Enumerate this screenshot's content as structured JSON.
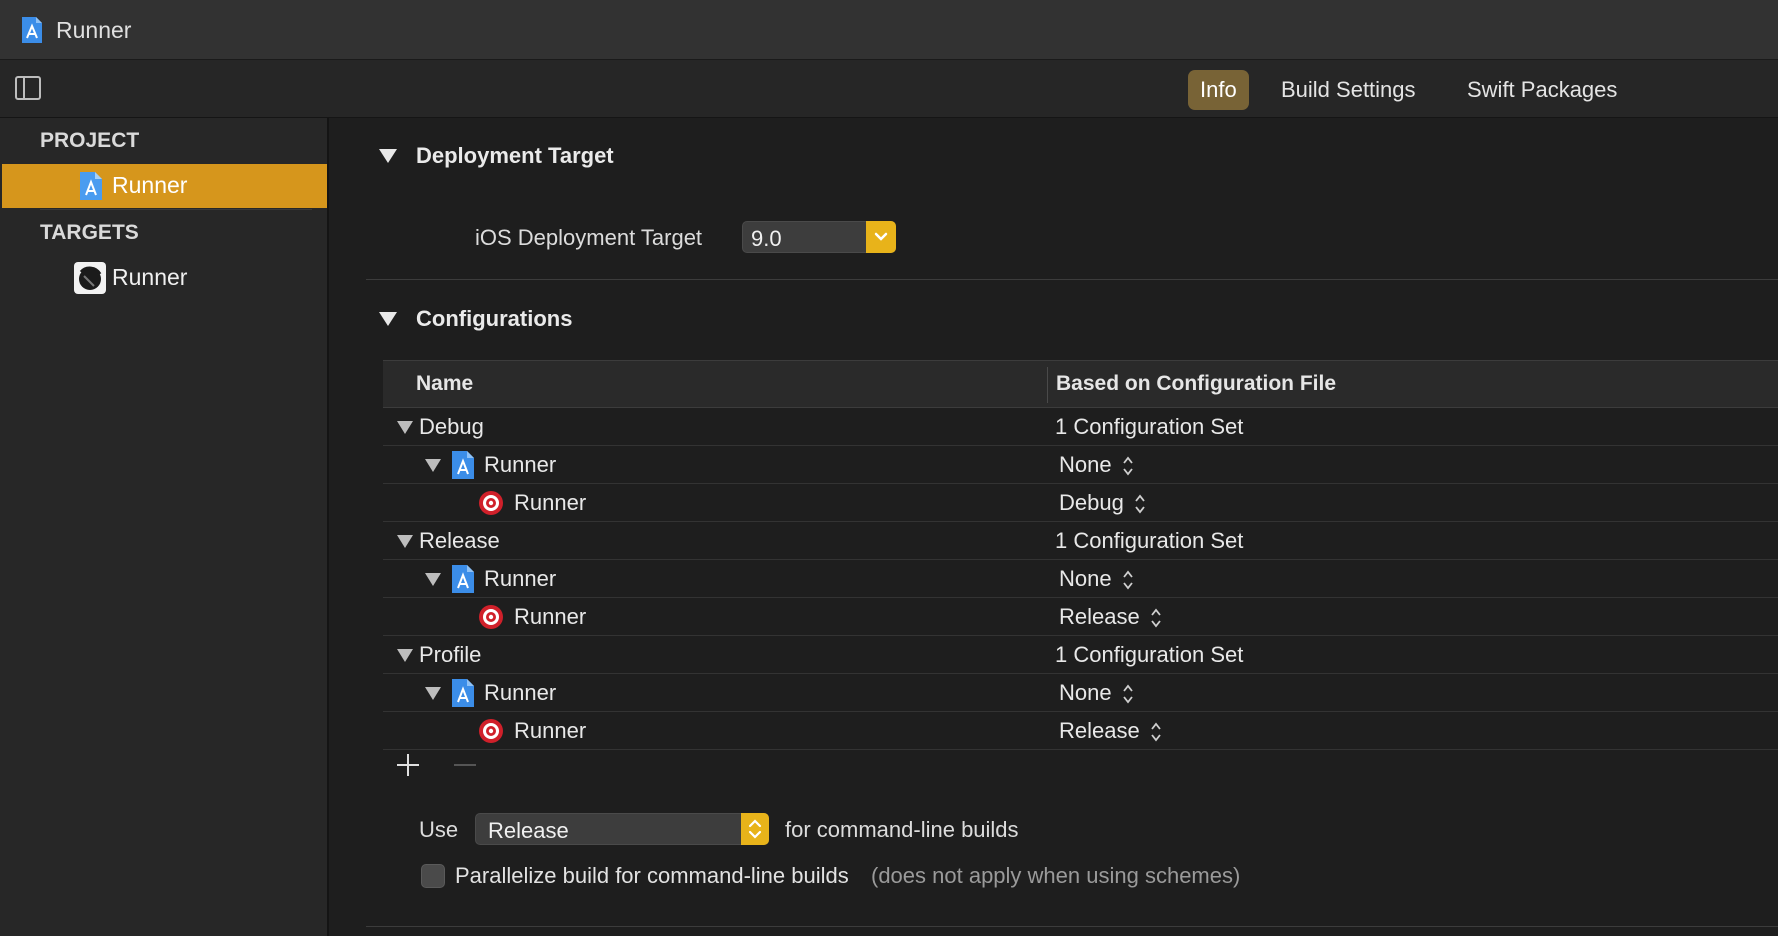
{
  "window": {
    "title": "Runner"
  },
  "toolbar": {
    "tabs": [
      {
        "label": "Info",
        "active": true
      },
      {
        "label": "Build Settings",
        "active": false
      },
      {
        "label": "Swift Packages",
        "active": false
      }
    ]
  },
  "sidebar": {
    "project_header": "PROJECT",
    "project_item": "Runner",
    "targets_header": "TARGETS",
    "target_item": "Runner"
  },
  "deployment": {
    "title": "Deployment Target",
    "label": "iOS Deployment Target",
    "value": "9.0"
  },
  "configurations": {
    "title": "Configurations",
    "col_name": "Name",
    "col_file": "Based on Configuration File",
    "groups": [
      {
        "name": "Debug",
        "summary": "1 Configuration Set",
        "project": {
          "name": "Runner",
          "file": "None"
        },
        "target": {
          "name": "Runner",
          "file": "Debug"
        }
      },
      {
        "name": "Release",
        "summary": "1 Configuration Set",
        "project": {
          "name": "Runner",
          "file": "None"
        },
        "target": {
          "name": "Runner",
          "file": "Release"
        }
      },
      {
        "name": "Profile",
        "summary": "1 Configuration Set",
        "project": {
          "name": "Runner",
          "file": "None"
        },
        "target": {
          "name": "Runner",
          "file": "Release"
        }
      }
    ]
  },
  "command_line": {
    "use_label": "Use",
    "selected": "Release",
    "suffix": "for command-line builds"
  },
  "parallelize": {
    "label": "Parallelize build for command-line builds",
    "note": "(does not apply when using schemes)",
    "checked": false
  },
  "colors": {
    "accent": "#d6961c",
    "tab_active": "#786336",
    "popup_cap": "#e8b31a",
    "target_icon": "#d0202a"
  }
}
